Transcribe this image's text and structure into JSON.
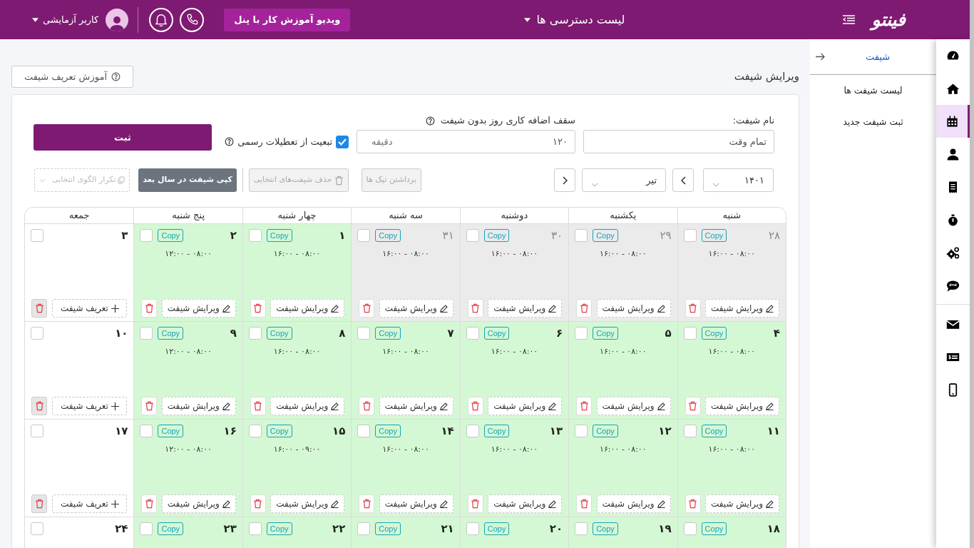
{
  "header": {
    "logo": "فینتو",
    "access_menu": "لیست دسترسی ها",
    "video_button": "ویدیو آموزش کار با پنل",
    "user_name": "کاربر آزمایشی"
  },
  "rail": {
    "items": [
      {
        "kind": "gauge",
        "selected": false
      },
      {
        "kind": "home",
        "selected": false
      },
      {
        "kind": "calendar",
        "selected": true
      },
      {
        "kind": "user",
        "selected": false
      },
      {
        "kind": "receipt",
        "selected": false
      },
      {
        "kind": "stopwatch",
        "selected": false
      },
      {
        "kind": "gears",
        "selected": false
      },
      {
        "kind": "sms",
        "selected": false
      }
    ],
    "bottom_items": [
      {
        "kind": "envelope",
        "selected": false
      },
      {
        "kind": "money",
        "selected": false
      },
      {
        "kind": "mobile",
        "selected": false
      }
    ]
  },
  "submenu": {
    "title": "شیفت",
    "items": [
      "لیست شیفت ها",
      "ثبت شیفت جدید"
    ]
  },
  "page": {
    "title": "ویرایش شیفت",
    "help_button": "آموزش تعریف شیفت"
  },
  "form": {
    "name_label": "نام شیفت:",
    "name_value": "تمام وقت",
    "overtime_label": "سقف اضافه کاری روز بدون شیفت",
    "overtime_value": "۱۲۰",
    "overtime_unit": "دقیقه",
    "holidays_label": "تبعیت از تعطیلات رسمی",
    "holidays_checked": true,
    "submit": "ثبت"
  },
  "toolbar": {
    "year": "۱۴۰۱",
    "month": "تیر",
    "clear_ticks": {
      "label": "برداشتن تیک ها",
      "disabled": true
    },
    "delete_selected": {
      "label": "حذف شیفت‌های انتخابی",
      "disabled": true
    },
    "copy_next_year": {
      "label": "کپی شیفت در سال بعد",
      "disabled": false
    },
    "repeat_pattern": {
      "label": "تکرار الگوی انتخابی",
      "disabled": true
    }
  },
  "calendar": {
    "columns": [
      "شنبه",
      "یکشنبه",
      "دوشنبه",
      "سه شنبه",
      "چهار شنبه",
      "پنج شنبه",
      "جمعه"
    ],
    "rows": [
      [
        {
          "kind": "shift",
          "day": "۲۸",
          "past": true,
          "checked": false,
          "copy": "Copy",
          "time": "۱۶:۰۰ - ۰۸:۰۰",
          "edit": "ویرایش شیفت"
        },
        {
          "kind": "shift",
          "day": "۲۹",
          "past": true,
          "checked": false,
          "copy": "Copy",
          "time": "۱۶:۰۰ - ۰۸:۰۰",
          "edit": "ویرایش شیفت"
        },
        {
          "kind": "shift",
          "day": "۳۰",
          "past": true,
          "checked": false,
          "copy": "Copy",
          "time": "۱۶:۰۰ - ۰۸:۰۰",
          "edit": "ویرایش شیفت"
        },
        {
          "kind": "shift",
          "day": "۳۱",
          "past": true,
          "checked": false,
          "copy": "Copy",
          "time": "۱۶:۰۰ - ۰۸:۰۰",
          "edit": "ویرایش شیفت"
        },
        {
          "kind": "shift",
          "day": "۱",
          "past": false,
          "checked": false,
          "copy": "Copy",
          "time": "۱۶:۰۰ - ۰۸:۰۰",
          "edit": "ویرایش شیفت"
        },
        {
          "kind": "shift",
          "day": "۲",
          "past": false,
          "checked": false,
          "copy": "Copy",
          "time": "۱۲:۰۰ - ۰۸:۰۰",
          "edit": "ویرایش شیفت"
        },
        {
          "kind": "empty",
          "day": "۳",
          "past": false,
          "checked": false,
          "define": "تعریف شیفت"
        }
      ],
      [
        {
          "kind": "shift",
          "day": "۴",
          "past": false,
          "checked": false,
          "copy": "Copy",
          "time": "۱۶:۰۰ - ۰۸:۰۰",
          "edit": "ویرایش شیفت"
        },
        {
          "kind": "shift",
          "day": "۵",
          "past": false,
          "checked": false,
          "copy": "Copy",
          "time": "۱۶:۰۰ - ۰۸:۰۰",
          "edit": "ویرایش شیفت"
        },
        {
          "kind": "shift",
          "day": "۶",
          "past": false,
          "checked": false,
          "copy": "Copy",
          "time": "۱۶:۰۰ - ۰۸:۰۰",
          "edit": "ویرایش شیفت"
        },
        {
          "kind": "shift",
          "day": "۷",
          "past": false,
          "checked": false,
          "copy": "Copy",
          "time": "۱۶:۰۰ - ۰۸:۰۰",
          "edit": "ویرایش شیفت"
        },
        {
          "kind": "shift",
          "day": "۸",
          "past": false,
          "checked": false,
          "copy": "Copy",
          "time": "۱۶:۰۰ - ۰۸:۰۰",
          "edit": "ویرایش شیفت"
        },
        {
          "kind": "shift",
          "day": "۹",
          "past": false,
          "checked": false,
          "copy": "Copy",
          "time": "۱۲:۰۰ - ۰۸:۰۰",
          "edit": "ویرایش شیفت"
        },
        {
          "kind": "empty",
          "day": "۱۰",
          "past": false,
          "checked": false,
          "define": "تعریف شیفت"
        }
      ],
      [
        {
          "kind": "shift",
          "day": "۱۱",
          "past": false,
          "checked": false,
          "copy": "Copy",
          "time": "۱۶:۰۰ - ۰۸:۰۰",
          "edit": "ویرایش شیفت"
        },
        {
          "kind": "shift",
          "day": "۱۲",
          "past": false,
          "checked": false,
          "copy": "Copy",
          "time": "۱۶:۰۰ - ۰۸:۰۰",
          "edit": "ویرایش شیفت"
        },
        {
          "kind": "shift",
          "day": "۱۳",
          "past": false,
          "checked": false,
          "copy": "Copy",
          "time": "۱۶:۰۰ - ۰۸:۰۰",
          "edit": "ویرایش شیفت"
        },
        {
          "kind": "shift",
          "day": "۱۴",
          "past": false,
          "checked": false,
          "copy": "Copy",
          "time": "۱۶:۰۰ - ۰۸:۰۰",
          "edit": "ویرایش شیفت"
        },
        {
          "kind": "shift",
          "day": "۱۵",
          "past": false,
          "checked": false,
          "copy": "Copy",
          "time": "۱۶:۰۰ - ۰۹:۰۰",
          "edit": "ویرایش شیفت"
        },
        {
          "kind": "shift",
          "day": "۱۶",
          "past": false,
          "checked": false,
          "copy": "Copy",
          "time": "۱۲:۰۰ - ۰۸:۰۰",
          "edit": "ویرایش شیفت"
        },
        {
          "kind": "empty",
          "day": "۱۷",
          "past": false,
          "checked": false,
          "define": "تعریف شیفت"
        }
      ],
      [
        {
          "kind": "shift",
          "day": "۱۸",
          "past": false,
          "checked": false,
          "copy": "Copy"
        },
        {
          "kind": "shift",
          "day": "۱۹",
          "past": false,
          "checked": false,
          "copy": "Copy"
        },
        {
          "kind": "shift",
          "day": "۲۰",
          "past": false,
          "checked": false,
          "copy": "Copy"
        },
        {
          "kind": "shift",
          "day": "۲۱",
          "past": false,
          "checked": false,
          "copy": "Copy"
        },
        {
          "kind": "shift",
          "day": "۲۲",
          "past": false,
          "checked": false,
          "copy": "Copy"
        },
        {
          "kind": "shift",
          "day": "۲۳",
          "past": false,
          "checked": false,
          "copy": "Copy"
        },
        {
          "kind": "empty",
          "day": "۲۴",
          "past": false,
          "checked": false
        }
      ]
    ]
  }
}
